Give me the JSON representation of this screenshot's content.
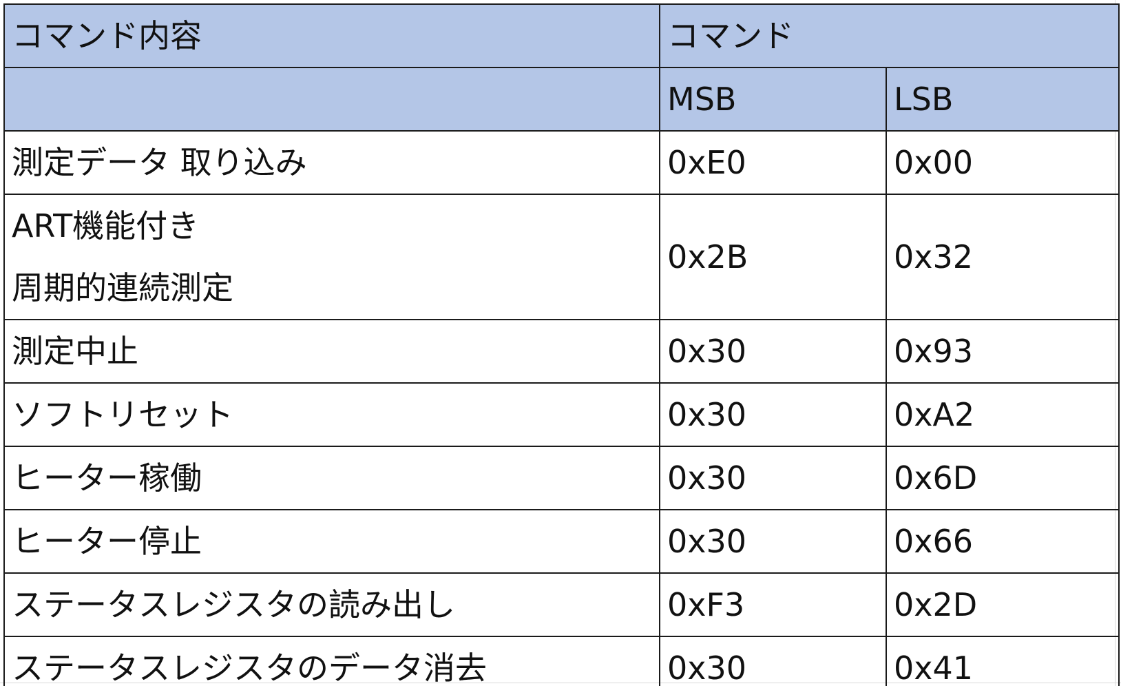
{
  "headers": {
    "content": "コマンド内容",
    "command": "コマンド",
    "msb": "MSB",
    "lsb": "LSB"
  },
  "rows": [
    {
      "content": [
        "測定データ 取り込み"
      ],
      "msb": "0xE0",
      "lsb": "0x00"
    },
    {
      "content": [
        "ART機能付き",
        "周期的連続測定"
      ],
      "msb": "0x2B",
      "lsb": "0x32"
    },
    {
      "content": [
        "測定中止"
      ],
      "msb": "0x30",
      "lsb": "0x93"
    },
    {
      "content": [
        "ソフトリセット"
      ],
      "msb": "0x30",
      "lsb": "0xA2"
    },
    {
      "content": [
        "ヒーター稼働"
      ],
      "msb": "0x30",
      "lsb": "0x6D"
    },
    {
      "content": [
        "ヒーター停止"
      ],
      "msb": "0x30",
      "lsb": "0x66"
    },
    {
      "content": [
        "ステータスレジスタの読み出し"
      ],
      "msb": "0xF3",
      "lsb": "0x2D"
    },
    {
      "content": [
        "ステータスレジスタのデータ消去"
      ],
      "msb": "0x30",
      "lsb": "0x41"
    }
  ]
}
